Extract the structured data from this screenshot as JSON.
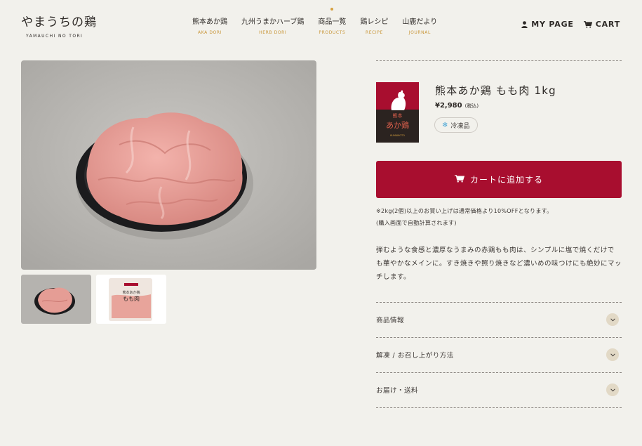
{
  "header": {
    "logo_jp": "やまうちの鶏",
    "logo_en": "YAMAUCHI NO TORI",
    "nav": [
      {
        "jp": "熊本あか鶏",
        "en": "AKA DORI",
        "active": false
      },
      {
        "jp": "九州うまかハーブ鶏",
        "en": "HERB DORI",
        "active": false
      },
      {
        "jp": "商品一覧",
        "en": "PRODUCTS",
        "active": true
      },
      {
        "jp": "鶏レシピ",
        "en": "RECIPE",
        "active": false
      },
      {
        "jp": "山鹿だより",
        "en": "JOURNAL",
        "active": false
      }
    ],
    "mypage_label": "MY PAGE",
    "cart_label": "CART"
  },
  "product": {
    "title": "熊本あか鶏 もも肉 1kg",
    "price": "¥2,980",
    "tax_note": "(税込)",
    "badge": "冷凍品",
    "package": {
      "name_line1": "熊本",
      "name_line2": "あか鶏",
      "sub": "KUMAMOTO"
    },
    "thumb_package_line1": "熊本あか鶏",
    "thumb_package_line2": "もも肉",
    "add_to_cart": "カートに追加する",
    "note_line1": "※2kg(2個)以上のお買い上げは通常価格より10%OFFとなります。",
    "note_line2": "(購入画面で自動計算されます)",
    "description_lines": [
      "弾むような食感と濃厚なうまみの赤鶏もも肉は、シンプルに塩で焼くだけで",
      "も華やかなメインに。すき焼きや照り焼きなど濃いめの味つけにも絶妙にマッ",
      "チします。"
    ]
  },
  "accordion": [
    {
      "label": "商品情報"
    },
    {
      "label": "解凍 / お召し上がり方法"
    },
    {
      "label": "お届け・送料"
    }
  ],
  "colors": {
    "background": "#f2f1ec",
    "accent_red": "#a80e2f",
    "nav_gold": "#c9973a",
    "chevron_bg": "#e2d9c6"
  },
  "icons": {
    "mypage": "user-icon",
    "cart": "cart-icon",
    "badge": "snowflake-icon",
    "accordion": "chevron-down-icon"
  }
}
